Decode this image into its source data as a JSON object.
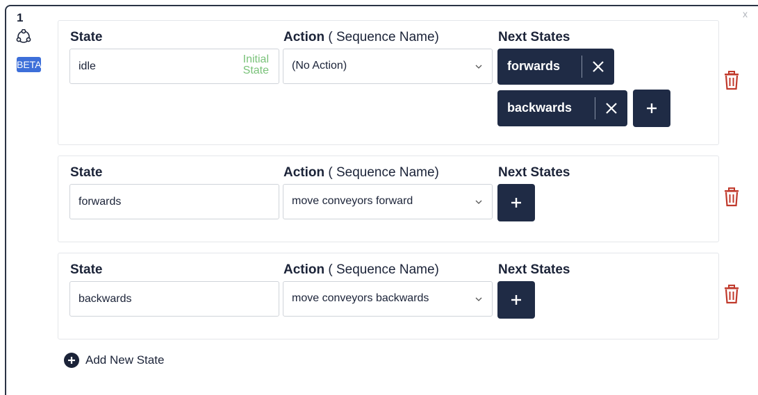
{
  "header": {
    "step_number": "1",
    "badge": "BETA",
    "close_label": "x"
  },
  "labels": {
    "state": "State",
    "action": "Action",
    "action_sub": " ( Sequence Name)",
    "next_states": "Next States"
  },
  "states": [
    {
      "name": "idle",
      "initial_tag_line1": "Initial",
      "initial_tag_line2": "State",
      "action": "(No Action)",
      "next_states": [
        "forwards",
        "backwards"
      ]
    },
    {
      "name": "forwards",
      "action": "move conveyors forward",
      "next_states": []
    },
    {
      "name": "backwards",
      "action": "move conveyors backwards",
      "next_states": []
    }
  ],
  "add_state_label": "Add New State",
  "colors": {
    "navy": "#1f2b45",
    "badge_blue": "#3d6fd9",
    "initial_green": "#79c279",
    "trash_red": "#c0392b"
  }
}
